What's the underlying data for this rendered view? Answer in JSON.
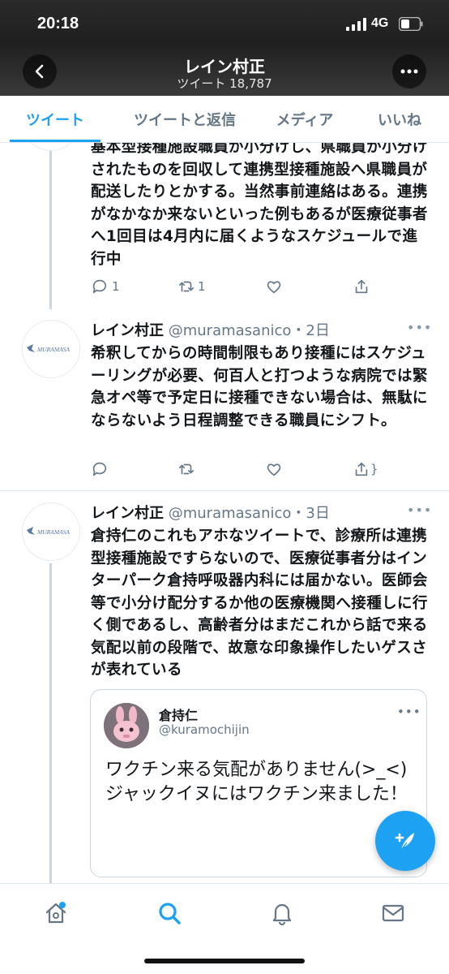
{
  "status_bar": {
    "time": "20:18",
    "network": "4G"
  },
  "header": {
    "profile_name": "レイン村正",
    "tweet_count": "ツイート 18,787"
  },
  "tabs": [
    {
      "label": "ツイート",
      "active": true
    },
    {
      "label": "ツイートと返信",
      "active": false
    },
    {
      "label": "メディア",
      "active": false
    },
    {
      "label": "いいね",
      "active": false
    }
  ],
  "tweets": [
    {
      "text": "基本型接種施設職員が小分けし、県職員が小分けされたものを回収して連携型接種施設へ県職員が配送したりとかする。当然事前連絡はある。連携がなかなか来ないといった例もあるが医療従事者へ1回目は4月内に届くようなスケジュールで進行中",
      "reply_count": "1",
      "retweet_count": "1"
    },
    {
      "author": "レイン村正",
      "handle": "@muramasanico",
      "time": "・2日",
      "avatar_text": "MURAMASA",
      "text": "希釈してからの時間制限もあり接種にはスケジューリングが必要、何百人と打つような病院では緊急オペ等で予定日に接種できない場合は、無駄にならないよう日程調整できる職員にシフト。"
    },
    {
      "author": "レイン村正",
      "handle": "@muramasanico",
      "time": "・3日",
      "avatar_text": "MURAMASA",
      "text": "倉持仁のこれもアホなツイートで、診療所は連携型接種施設ですらないので、医療従事者分はインターパーク倉持呼吸器内科には届かない。医師会等で小分け配分するか他の医療機関へ接種しに行く側であるし、高齢者分はまだこれから話で来る気配以前の段階で、故意な印象操作したいゲスさが表れている",
      "quote": {
        "author": "倉持仁",
        "handle": "@kuramochijin",
        "text": "ワクチン来る気配がありません(>_<)\nジャックイヌにはワクチン来ました！"
      }
    }
  ],
  "colors": {
    "accent": "#1da1f2",
    "text": "#14171a",
    "muted": "#657786",
    "border": "#e1e8ed"
  },
  "icons": [
    "back-arrow-icon",
    "more-icon",
    "reply-icon",
    "retweet-icon",
    "like-icon",
    "share-icon",
    "home-icon",
    "search-icon",
    "notifications-icon",
    "messages-icon",
    "compose-icon"
  ]
}
